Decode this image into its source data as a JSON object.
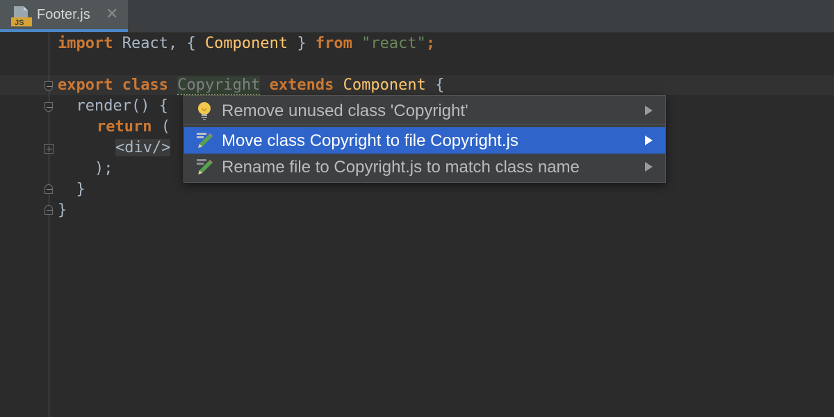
{
  "tab": {
    "label": "Footer.js",
    "icon": "js-file-icon",
    "icon_badge": "JS",
    "close": "✕"
  },
  "code": {
    "l1": {
      "kw_import": "import",
      "react": " React, { ",
      "component": "Component",
      "close": " } ",
      "kw_from": "from",
      "space": " ",
      "str": "\"react\"",
      "semi": ";"
    },
    "l3": {
      "kw_export": "export",
      "kw_class": " class ",
      "name": "Copyright",
      "kw_extends": " extends ",
      "base": "Component",
      "brace": " {"
    },
    "l4": {
      "text": "  render() {"
    },
    "l5": {
      "kw_return": "return",
      "paren": " ("
    },
    "l6": {
      "tag": "<div/>"
    },
    "l7": {
      "text": "    );"
    },
    "l8": {
      "text": "  }"
    },
    "l9": {
      "text": "}"
    }
  },
  "popup": {
    "items": [
      {
        "label": "Remove unused class 'Copyright'",
        "icon": "lightbulb-icon",
        "selected": false
      },
      {
        "label": "Move class Copyright to file Copyright.js",
        "icon": "pencil-icon",
        "selected": true
      },
      {
        "label": "Rename file to Copyright.js to match class name",
        "icon": "pencil-icon",
        "selected": false
      }
    ]
  },
  "colors": {
    "keyword": "#cc7832",
    "identifier": "#ffc66d",
    "string": "#6a8759",
    "selection": "#2f65ca",
    "background": "#2b2b2b"
  }
}
